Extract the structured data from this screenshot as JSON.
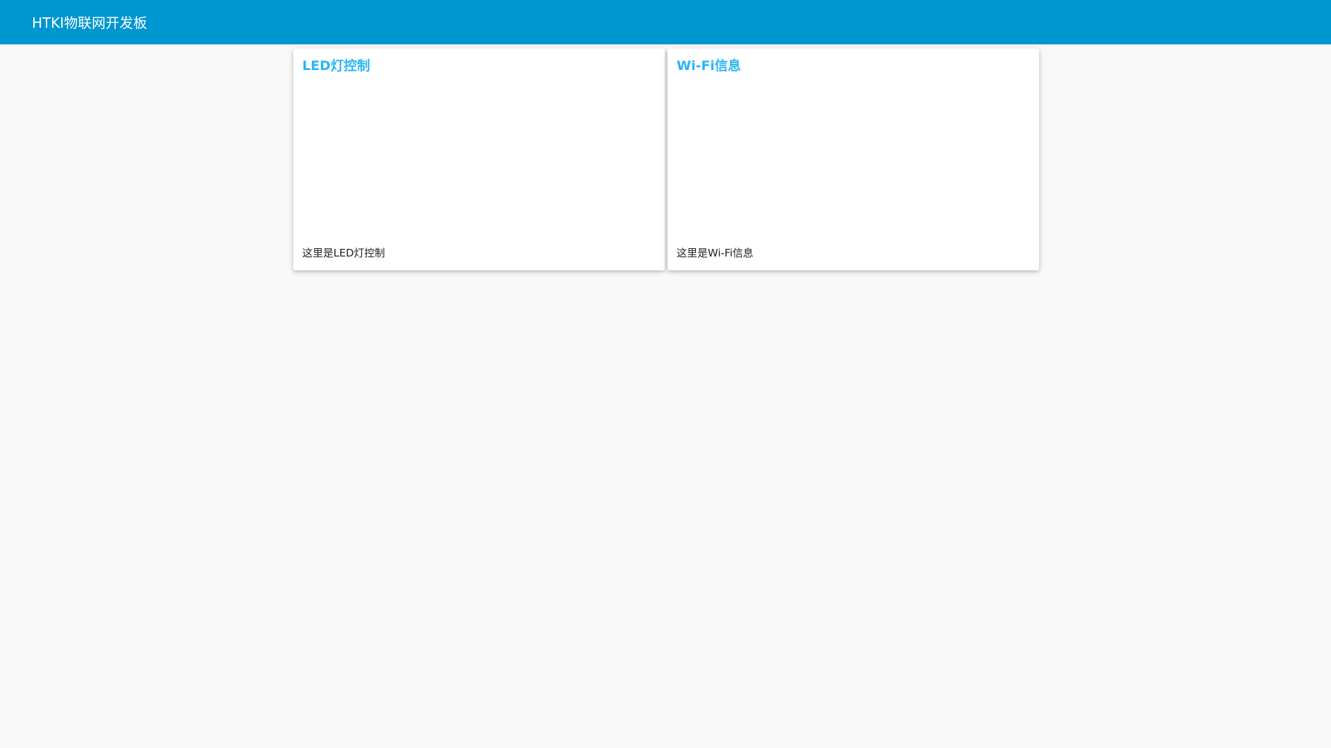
{
  "header": {
    "title": "HTKI物联网开发板"
  },
  "cards": [
    {
      "title": "LED灯控制",
      "text": "这里是LED灯控制"
    },
    {
      "title": "Wi-Fi信息",
      "text": "这里是Wi-Fi信息"
    }
  ],
  "colors": {
    "header_bg": "#0096d0",
    "header_text": "#ffffff",
    "card_title": "#29b6f6",
    "page_bg": "#f9f9f9"
  }
}
